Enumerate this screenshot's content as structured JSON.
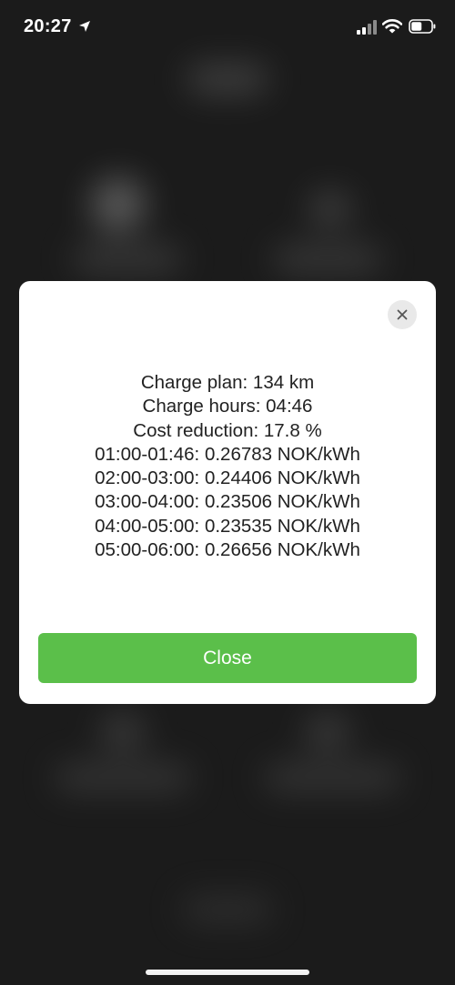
{
  "status_bar": {
    "time": "20:27",
    "icons": [
      "location-arrow-icon",
      "cellular-signal-icon",
      "wifi-icon",
      "battery-icon"
    ]
  },
  "dialog": {
    "lines": [
      "Charge plan: 134 km",
      "Charge hours: 04:46",
      "Cost reduction: 17.8 %",
      "01:00-01:46: 0.26783 NOK/kWh",
      "02:00-03:00: 0.24406 NOK/kWh",
      "03:00-04:00: 0.23506 NOK/kWh",
      "04:00-05:00: 0.23535 NOK/kWh",
      "05:00-06:00: 0.26656 NOK/kWh"
    ],
    "close_icon": "close-icon",
    "close_button_label": "Close"
  },
  "colors": {
    "background": "#1b1b1b",
    "dialog_background": "#ffffff",
    "accent_green": "#5bbf4a",
    "close_icon_circle": "#e9e9e9"
  }
}
